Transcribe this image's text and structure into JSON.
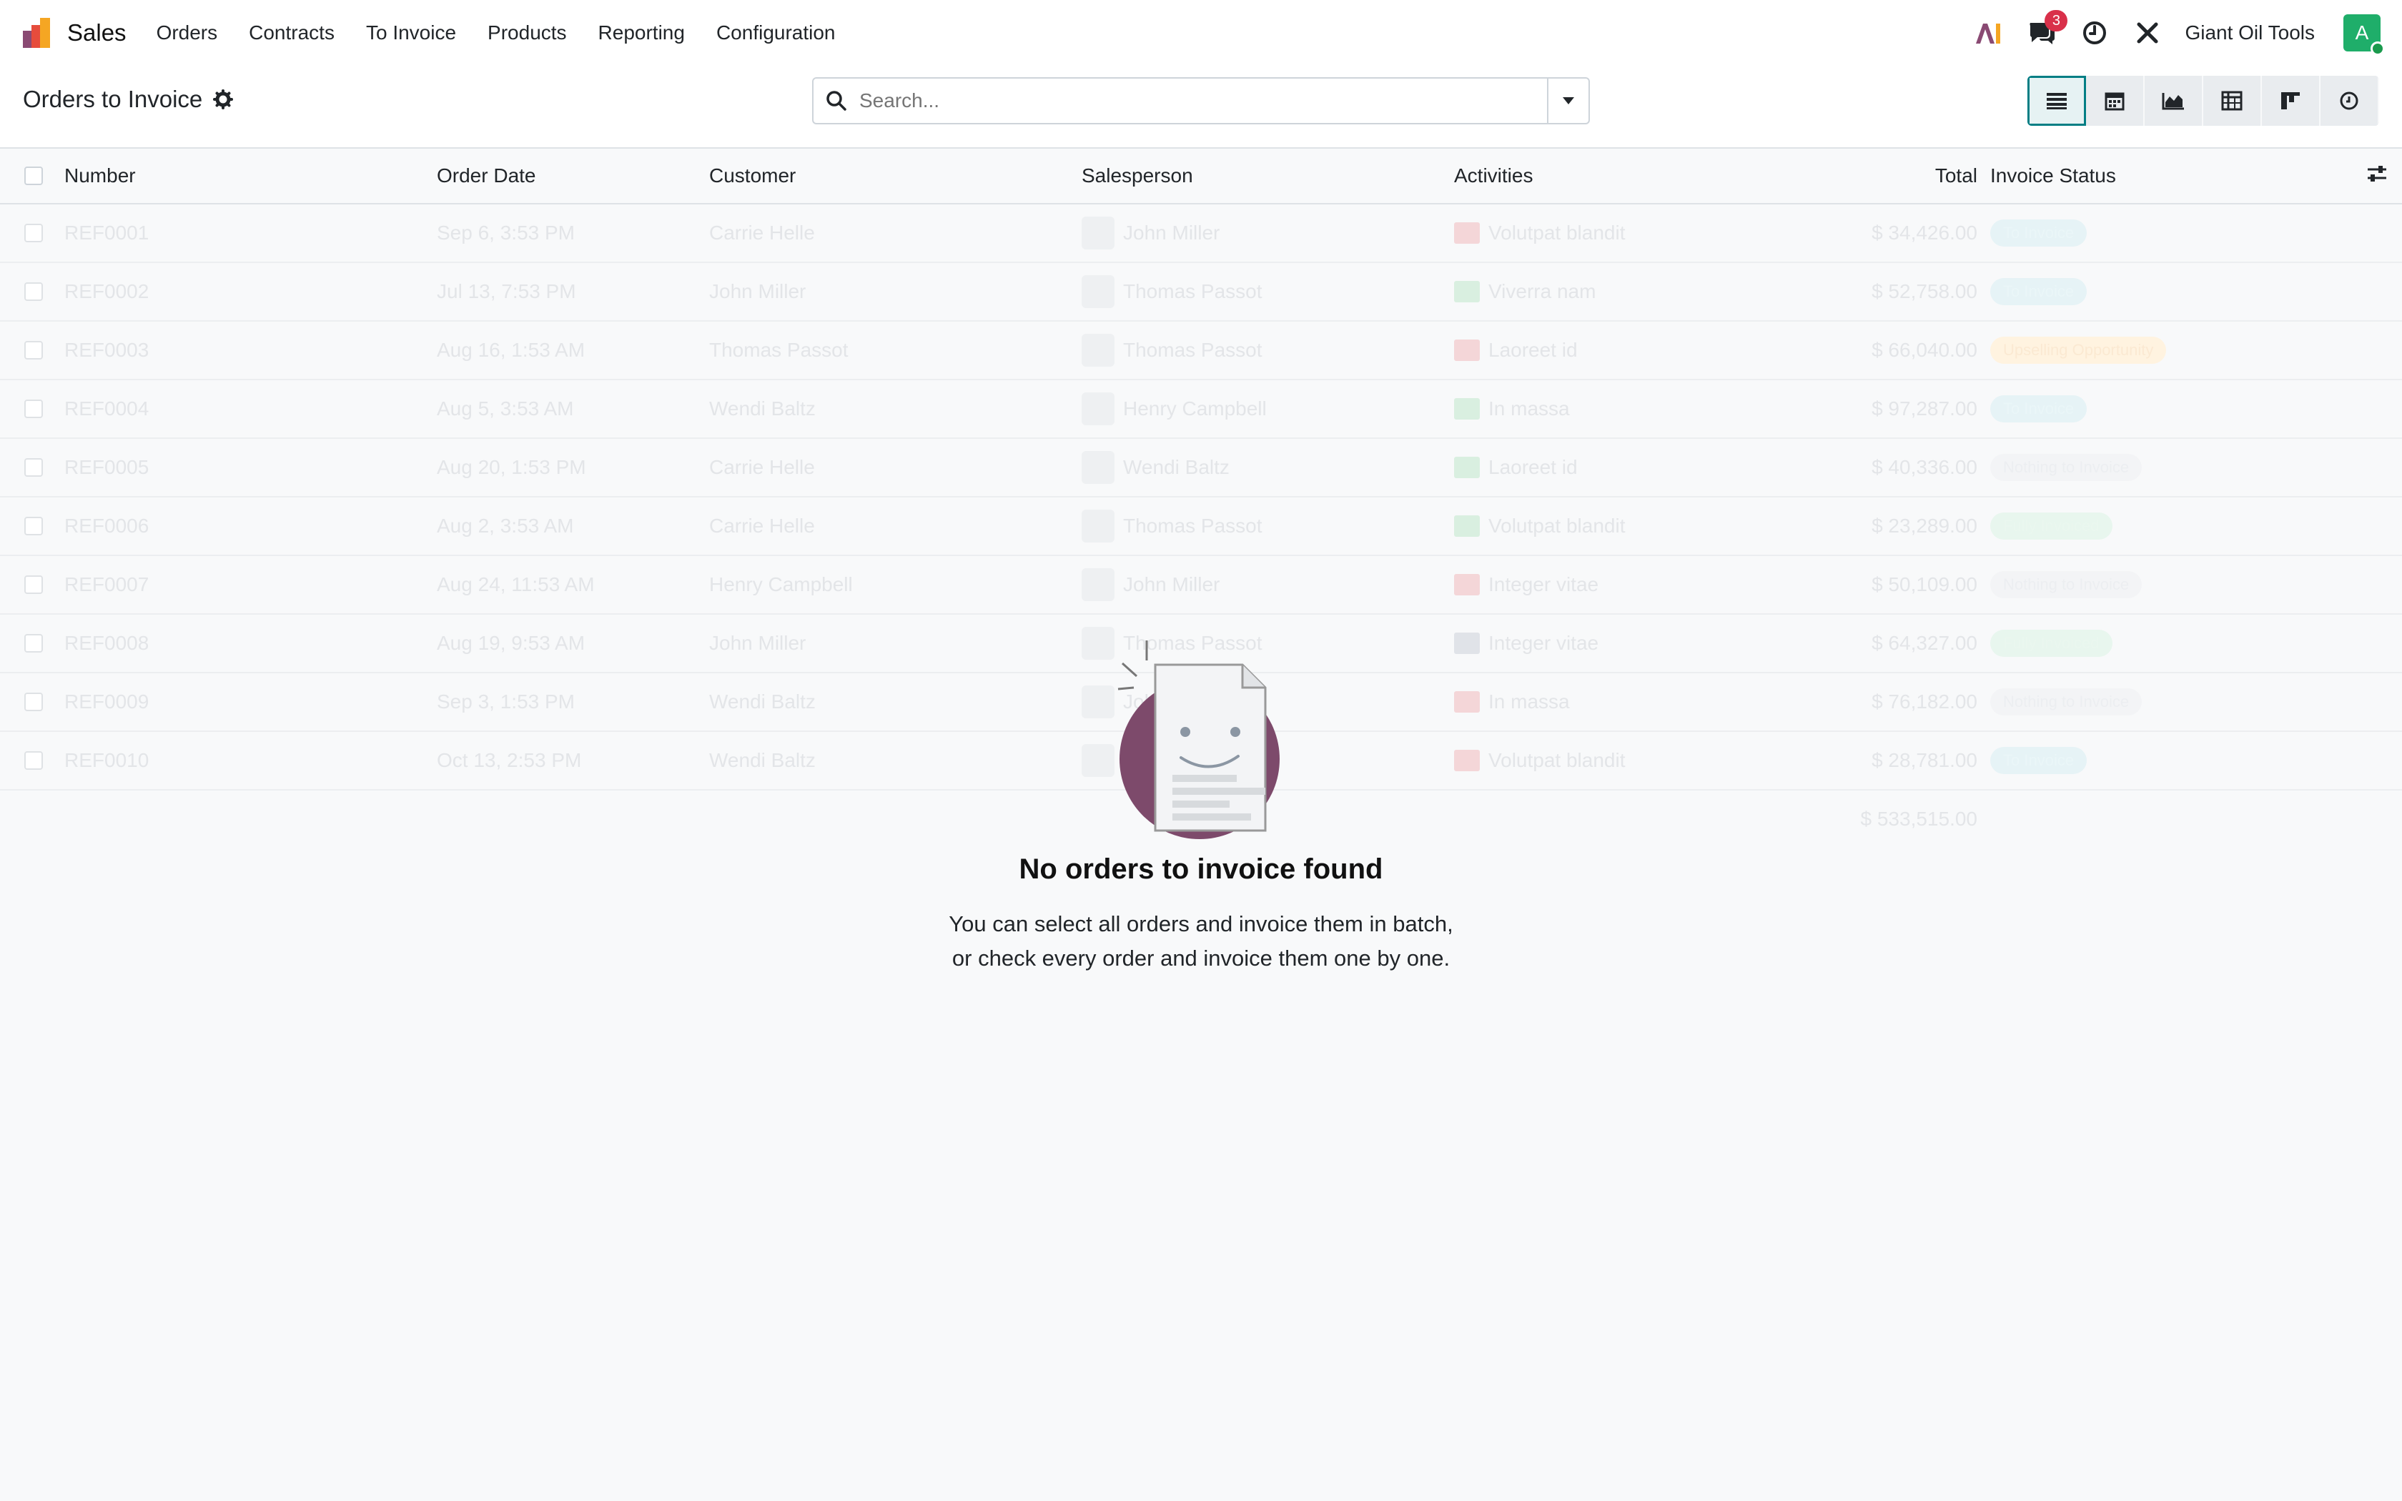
{
  "nav": {
    "app_name": "Sales",
    "menu": [
      "Orders",
      "Contracts",
      "To Invoice",
      "Products",
      "Reporting",
      "Configuration"
    ],
    "message_count": "3",
    "company": "Giant Oil Tools",
    "avatar_letter": "A"
  },
  "control": {
    "title": "Orders to Invoice",
    "search_placeholder": "Search..."
  },
  "table": {
    "headers": {
      "number": "Number",
      "order_date": "Order Date",
      "customer": "Customer",
      "salesperson": "Salesperson",
      "activities": "Activities",
      "total": "Total",
      "invoice_status": "Invoice Status"
    },
    "rows": [
      {
        "number": "REF0001",
        "date": "Sep 6, 3:53 PM",
        "customer": "Carrie Helle",
        "salesperson": "John Miller",
        "activity": "Volutpat blandit",
        "total": "$ 34,426.00",
        "status": "To Invoice"
      },
      {
        "number": "REF0002",
        "date": "Jul 13, 7:53 PM",
        "customer": "John Miller",
        "salesperson": "Thomas Passot",
        "activity": "Viverra nam",
        "total": "$ 52,758.00",
        "status": "To Invoice"
      },
      {
        "number": "REF0003",
        "date": "Aug 16, 1:53 AM",
        "customer": "Thomas Passot",
        "salesperson": "Thomas Passot",
        "activity": "Laoreet id",
        "total": "$ 66,040.00",
        "status": "Upselling Opportunity"
      },
      {
        "number": "REF0004",
        "date": "Aug 5, 3:53 AM",
        "customer": "Wendi Baltz",
        "salesperson": "Henry Campbell",
        "activity": "In massa",
        "total": "$ 97,287.00",
        "status": "To Invoice"
      },
      {
        "number": "REF0005",
        "date": "Aug 20, 1:53 PM",
        "customer": "Carrie Helle",
        "salesperson": "Wendi Baltz",
        "activity": "Laoreet id",
        "total": "$ 40,336.00",
        "status": "Nothing to Invoice"
      },
      {
        "number": "REF0006",
        "date": "Aug 2, 3:53 AM",
        "customer": "Carrie Helle",
        "salesperson": "Thomas Passot",
        "activity": "Volutpat blandit",
        "total": "$ 23,289.00",
        "status": "Fully Invoiced"
      },
      {
        "number": "REF0007",
        "date": "Aug 24, 11:53 AM",
        "customer": "Henry Campbell",
        "salesperson": "John Miller",
        "activity": "Integer vitae",
        "total": "$ 50,109.00",
        "status": "Nothing to Invoice"
      },
      {
        "number": "REF0008",
        "date": "Aug 19, 9:53 AM",
        "customer": "John Miller",
        "salesperson": "Thomas Passot",
        "activity": "Integer vitae",
        "total": "$ 64,327.00",
        "status": "Fully Invoiced"
      },
      {
        "number": "REF0009",
        "date": "Sep 3, 1:53 PM",
        "customer": "Wendi Baltz",
        "salesperson": "John Miller",
        "activity": "In massa",
        "total": "$ 76,182.00",
        "status": "Nothing to Invoice"
      },
      {
        "number": "REF0010",
        "date": "Oct 13, 2:53 PM",
        "customer": "Wendi Baltz",
        "salesperson": "Thomas Passot",
        "activity": "Volutpat blandit",
        "total": "$ 28,781.00",
        "status": "To Invoice"
      }
    ],
    "grand_total": "$ 533,515.00"
  },
  "empty_state": {
    "title": "No orders to invoice found",
    "line1": "You can select all orders and invoice them in batch,",
    "line2": "or check every order and invoice them one by one."
  },
  "colors": {
    "accent": "#017e84",
    "badge": "#d9304a",
    "avatar": "#1fae6a"
  }
}
